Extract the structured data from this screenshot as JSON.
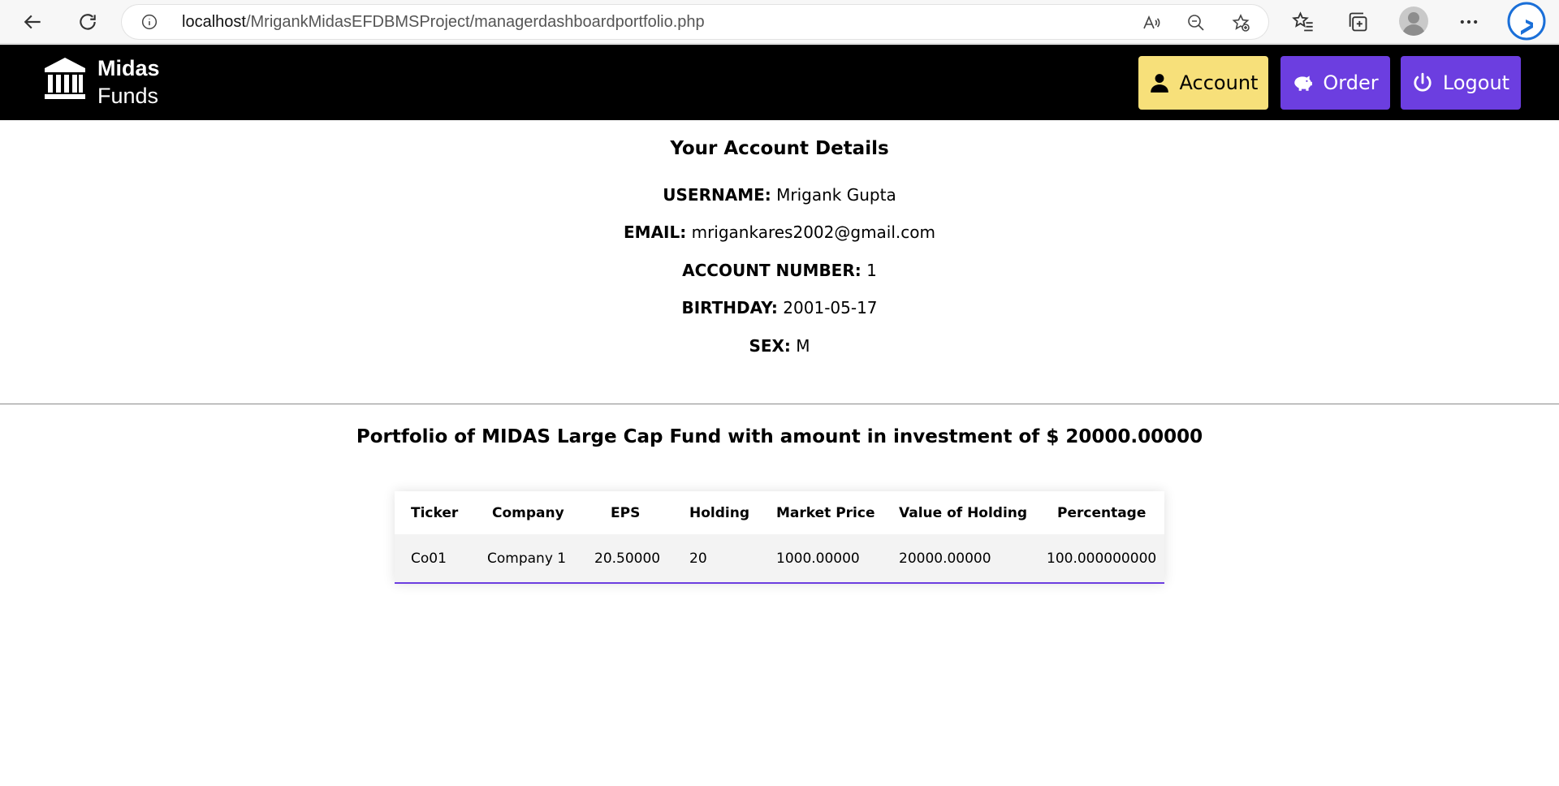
{
  "browser": {
    "url_host": "localhost",
    "url_path": "/MrigankMidasEFDBMSProject/managerdashboardportfolio.php"
  },
  "header": {
    "logo_line1": "Midas",
    "logo_line2": "Funds",
    "account_label": "Account",
    "order_label": "Order",
    "logout_label": "Logout",
    "colors": {
      "account_bg": "#f7e07a",
      "primary": "#6c3ee0",
      "header_bg": "#000000"
    }
  },
  "details": {
    "title": "Your Account Details",
    "username_label": "USERNAME:",
    "username_value": "Mrigank Gupta",
    "email_label": "EMAIL:",
    "email_value": "mrigankares2002@gmail.com",
    "account_label": "ACCOUNT NUMBER:",
    "account_value": "1",
    "birthday_label": "BIRTHDAY:",
    "birthday_value": "2001-05-17",
    "sex_label": "SEX:",
    "sex_value": "M"
  },
  "portfolio": {
    "title": "Portfolio of MIDAS Large Cap Fund with amount in investment of $ 20000.00000",
    "columns": [
      "Ticker",
      "Company",
      "EPS",
      "Holding",
      "Market Price",
      "Value of Holding",
      "Percentage"
    ],
    "rows": [
      [
        "Co01",
        "Company 1",
        "20.50000",
        "20",
        "1000.00000",
        "20000.00000",
        "100.000000000"
      ]
    ]
  }
}
